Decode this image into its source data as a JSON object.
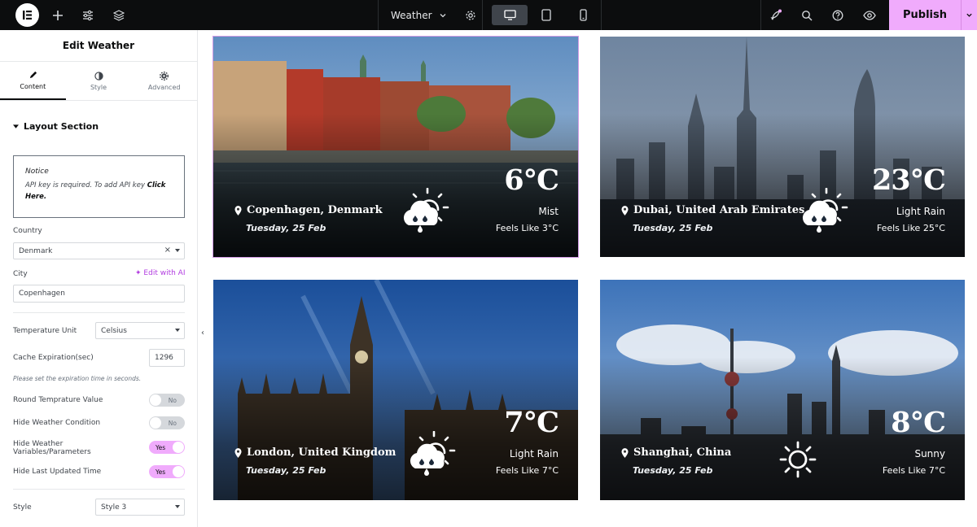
{
  "topbar": {
    "title": "Weather",
    "publish": "Publish"
  },
  "panel": {
    "title": "Edit Weather",
    "tabs": [
      "Content",
      "Style",
      "Advanced"
    ],
    "section": "Layout Section",
    "notice_title": "Notice",
    "notice_text": "API key is required. To add API key ",
    "notice_link": "Click Here.",
    "country_label": "Country",
    "country_value": "Denmark",
    "city_label": "City",
    "edit_ai": "Edit with AI",
    "city_value": "Copenhagen",
    "temp_unit_label": "Temperature Unit",
    "temp_unit_value": "Celsius",
    "cache_label": "Cache Expiration(sec)",
    "cache_value": "1296",
    "cache_hint": "Please set the expiration time in seconds.",
    "round_label": "Round Temprature Value",
    "hide_cond_label": "Hide Weather Condition",
    "hide_vars_label_1": "Hide Weather",
    "hide_vars_label_2": "Variables/Parameters",
    "hide_updated_label": "Hide Last Updated Time",
    "style_label": "Style",
    "style_value": "Style 3",
    "toggle_no": "No",
    "toggle_yes": "Yes",
    "clear_symbol": "×"
  },
  "cards": [
    {
      "city": "Copenhagen, Denmark",
      "date": "Tuesday, 25 Feb",
      "temp": "6°C",
      "condition": "Mist",
      "feels": "Feels Like 3°C",
      "icon": "cloud-sun-rain-icon"
    },
    {
      "city": "Dubai, United Arab Emirates",
      "date": "Tuesday, 25 Feb",
      "temp": "23°C",
      "condition": "Light Rain",
      "feels": "Feels Like 25°C",
      "icon": "cloud-sun-rain-icon"
    },
    {
      "city": "London, United Kingdom",
      "date": "Tuesday, 25 Feb",
      "temp": "7°C",
      "condition": "Light Rain",
      "feels": "Feels Like 7°C",
      "icon": "cloud-sun-rain-icon"
    },
    {
      "city": "Shanghai, China",
      "date": "Tuesday, 25 Feb",
      "temp": "8°C",
      "condition": "Sunny",
      "feels": "Feels Like 7°C",
      "icon": "sun-icon"
    }
  ],
  "colors": {
    "accent": "#f0abfc",
    "topbar_bg": "#0c0d0e"
  }
}
